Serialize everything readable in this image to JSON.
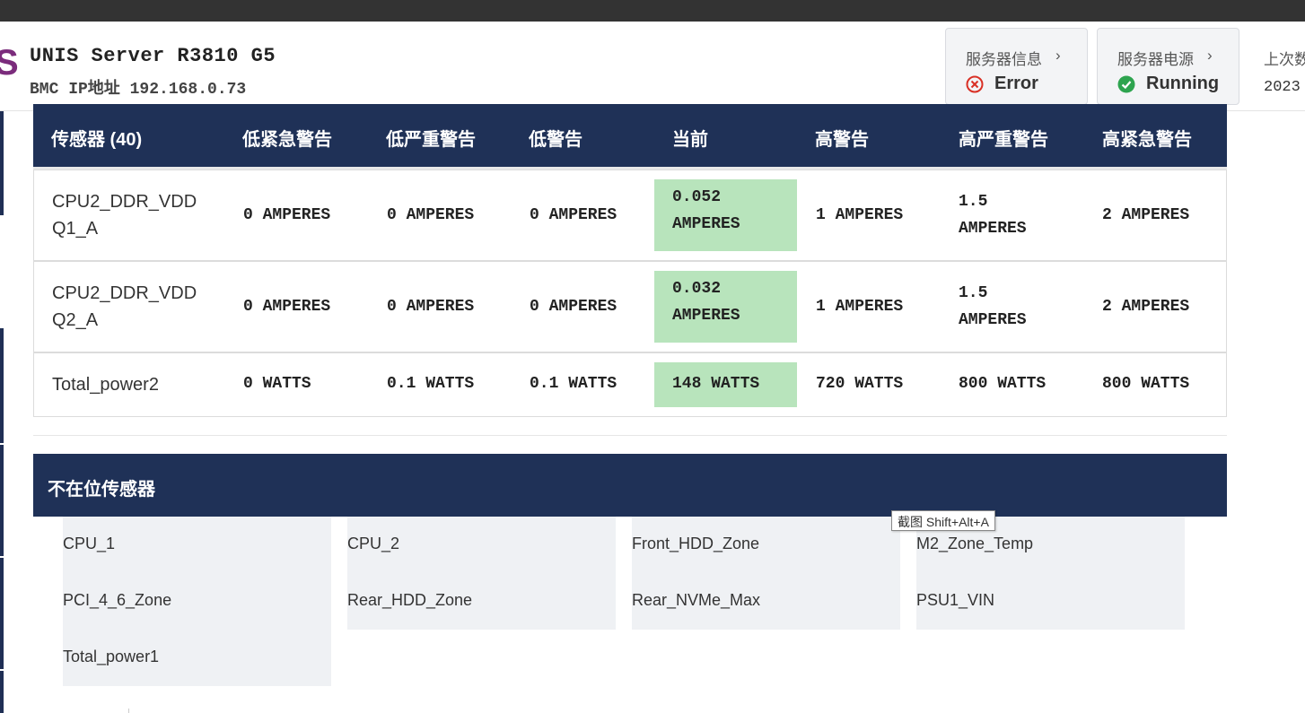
{
  "header": {
    "brand_char": "S",
    "server_title": "UNIS Server R3810 G5",
    "bmc_ip": "BMC IP地址 192.168.0.73",
    "server_info": {
      "label": "服务器信息",
      "status": "Error",
      "status_color": "#d93025"
    },
    "server_power": {
      "label": "服务器电源",
      "status": "Running",
      "status_color": "#2ea44f"
    },
    "last_label": "上次数",
    "last_value": "2023"
  },
  "sensor_table": {
    "columns": [
      "传感器 (40)",
      "低紧急警告",
      "低严重警告",
      "低警告",
      "当前",
      "高警告",
      "高严重警告",
      "高紧急警告"
    ],
    "rows": [
      {
        "name_line1": "CPU2_DDR_VDD",
        "name_line2": "Q1_A",
        "low_critical": "0 AMPERES",
        "low_severe": "0 AMPERES",
        "low_warn": "0 AMPERES",
        "current_line1": "0.052",
        "current_line2": "AMPERES",
        "high_warn": "1 AMPERES",
        "high_severe_line1": "1.5",
        "high_severe_line2": "AMPERES",
        "high_critical": "2 AMPERES"
      },
      {
        "name_line1": "CPU2_DDR_VDD",
        "name_line2": "Q2_A",
        "low_critical": "0 AMPERES",
        "low_severe": "0 AMPERES",
        "low_warn": "0 AMPERES",
        "current_line1": "0.032",
        "current_line2": "AMPERES",
        "high_warn": "1 AMPERES",
        "high_severe_line1": "1.5",
        "high_severe_line2": "AMPERES",
        "high_critical": "2 AMPERES"
      },
      {
        "name": "Total_power2",
        "low_critical": "0 WATTS",
        "low_severe": "0.1 WATTS",
        "low_warn": "0.1 WATTS",
        "current": "148 WATTS",
        "high_warn": "720 WATTS",
        "high_severe": "800 WATTS",
        "high_critical": "800 WATTS"
      }
    ],
    "current_bg": "#b8e4bc"
  },
  "absent": {
    "title": "不在位传感器",
    "columns": [
      [
        "CPU_1",
        "PCI_4_6_Zone",
        "Total_power1"
      ],
      [
        "CPU_2",
        "Rear_HDD_Zone"
      ],
      [
        "Front_HDD_Zone",
        "Rear_NVMe_Max"
      ],
      [
        "M2_Zone_Temp",
        "PSU1_VIN"
      ]
    ]
  },
  "tooltip": "截图 Shift+Alt+A",
  "colors": {
    "header_navy": "#1f3157",
    "brand": "#7b2c7c"
  }
}
